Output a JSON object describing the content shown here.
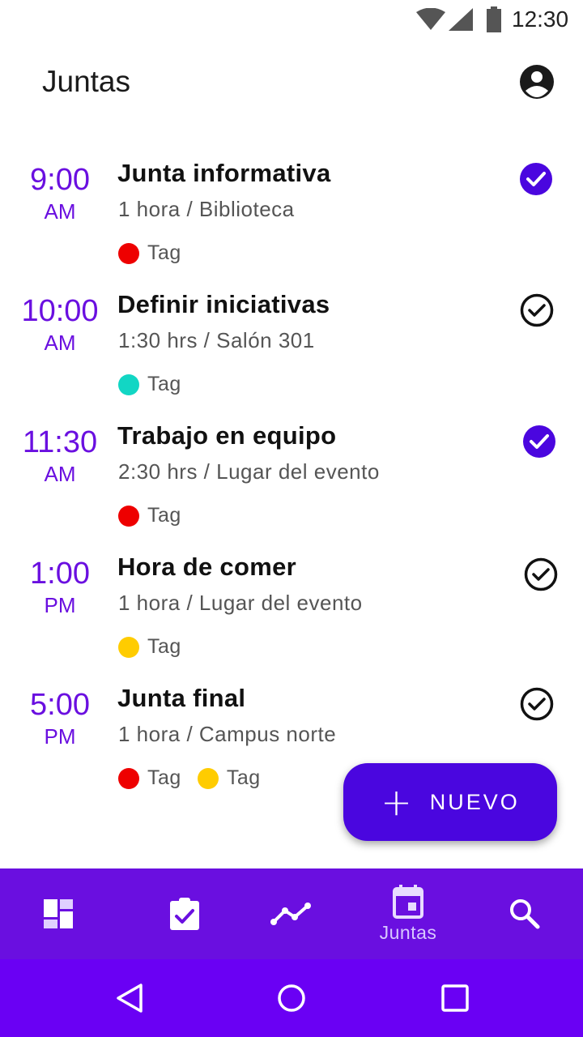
{
  "status_bar": {
    "time": "12:30",
    "icons": [
      "wifi-icon",
      "signal-icon",
      "battery-icon"
    ]
  },
  "app_bar": {
    "title": "Juntas",
    "account_icon": "account-circle-icon"
  },
  "meetings": [
    {
      "time": "9:00",
      "ampm": "AM",
      "title": "Junta informativa",
      "detail": "1 hora / Biblioteca",
      "tags": [
        {
          "label": "Tag",
          "color": "#ee0000"
        }
      ],
      "checked": true
    },
    {
      "time": "10:00",
      "ampm": "AM",
      "title": "Definir iniciativas",
      "detail": "1:30 hrs / Salón 301",
      "tags": [
        {
          "label": "Tag",
          "color": "#12d6c4"
        }
      ],
      "checked": false
    },
    {
      "time": "11:30",
      "ampm": "AM",
      "title": "Trabajo en equipo",
      "detail": "2:30 hrs / Lugar del evento",
      "tags": [
        {
          "label": "Tag",
          "color": "#ee0000"
        }
      ],
      "checked": true
    },
    {
      "time": "1:00",
      "ampm": "PM",
      "title": "Hora de comer",
      "detail": "1 hora / Lugar del evento",
      "tags": [
        {
          "label": "Tag",
          "color": "#ffcc00"
        }
      ],
      "checked": false
    },
    {
      "time": "5:00",
      "ampm": "PM",
      "title": "Junta final",
      "detail": "1 hora / Campus norte",
      "tags": [
        {
          "label": "Tag",
          "color": "#ee0000"
        },
        {
          "label": "Tag",
          "color": "#ffcc00"
        }
      ],
      "checked": false
    }
  ],
  "fab": {
    "label": "NUEVO",
    "icon": "plus-icon"
  },
  "bottom_nav": {
    "items": [
      {
        "icon": "dashboard-icon",
        "label": ""
      },
      {
        "icon": "assignment-check-icon",
        "label": ""
      },
      {
        "icon": "trending-icon",
        "label": ""
      },
      {
        "icon": "calendar-icon",
        "label": "Juntas",
        "active": true
      },
      {
        "icon": "search-icon",
        "label": ""
      }
    ]
  },
  "system_nav": [
    "back-icon",
    "home-icon",
    "recents-icon"
  ],
  "colors": {
    "accent": "#6a0fe0",
    "fab": "#4a06df",
    "check_filled": "#4a06df",
    "system_nav": "#6a00f4"
  }
}
